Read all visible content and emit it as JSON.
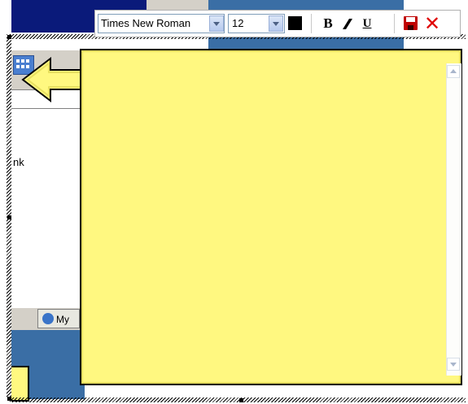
{
  "toolbar": {
    "font_family": "Times New Roman",
    "font_size": "12",
    "text_color": "#000000",
    "bold_label": "B",
    "italic_label": "I",
    "underline_label": "U"
  },
  "background": {
    "window_text_fragment": "nk",
    "taskbar_button_label": "My"
  },
  "note": {
    "background_color": "#fff880",
    "text": ""
  },
  "icons": {
    "save": "floppy-disk-icon",
    "close": "close-x-icon",
    "dropdown": "chevron-down-icon",
    "scroll_up": "scroll-up-icon",
    "scroll_down": "scroll-down-icon"
  }
}
